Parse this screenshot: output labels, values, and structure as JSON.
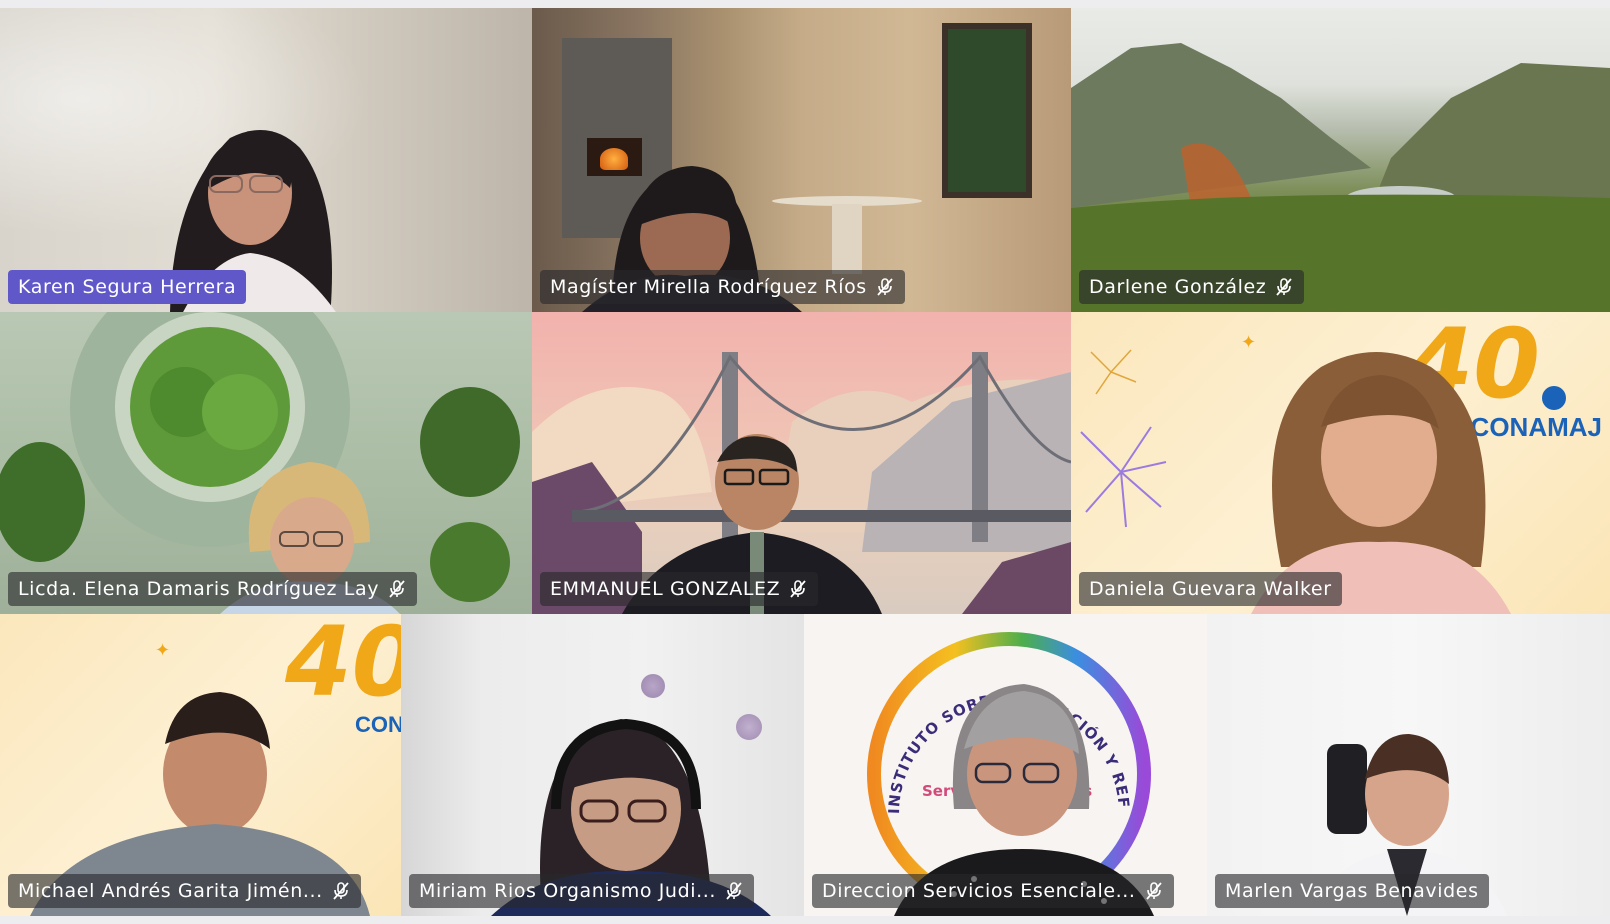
{
  "participants": [
    {
      "name": "Karen Segura Herrera",
      "muted": false,
      "active": true
    },
    {
      "name": "Magíster Mirella Rodríguez Ríos",
      "muted": true,
      "active": false
    },
    {
      "name": "Darlene González",
      "muted": true,
      "active": false
    },
    {
      "name": "Licda.  Elena Damaris Rodríguez Lay",
      "muted": true,
      "active": false
    },
    {
      "name": "EMMANUEL GONZALEZ",
      "muted": true,
      "active": false
    },
    {
      "name": "Daniela Guevara Walker",
      "muted": false,
      "active": false
    },
    {
      "name": "Michael Andrés Garita Jimén...",
      "muted": true,
      "active": false
    },
    {
      "name": "Miriam Rios Organismo Judi...",
      "muted": true,
      "active": false
    },
    {
      "name": "Direccion Servicios Esenciale...",
      "muted": true,
      "active": false
    },
    {
      "name": "Marlen Vargas Benavides",
      "muted": false,
      "active": false
    }
  ],
  "backgrounds": {
    "conamaj_number": "40",
    "conamaj_brand": "CONAMAJ",
    "conamaj_brand_partial": "CON",
    "institute_ring_text": "INSTITUTO SOBRE MIGRACIÓN Y REFUGIO LGBTIQ PARA CENTROAMÉRICA",
    "institute_inner_text": "Servicios Esenciales"
  },
  "colors": {
    "active_speaker_tag": "#6058c8",
    "tag_background": "#28282c",
    "conamaj_orange": "#f0a818",
    "conamaj_blue": "#1a63b8"
  },
  "icons": {
    "mute": "microphone-muted-icon"
  }
}
